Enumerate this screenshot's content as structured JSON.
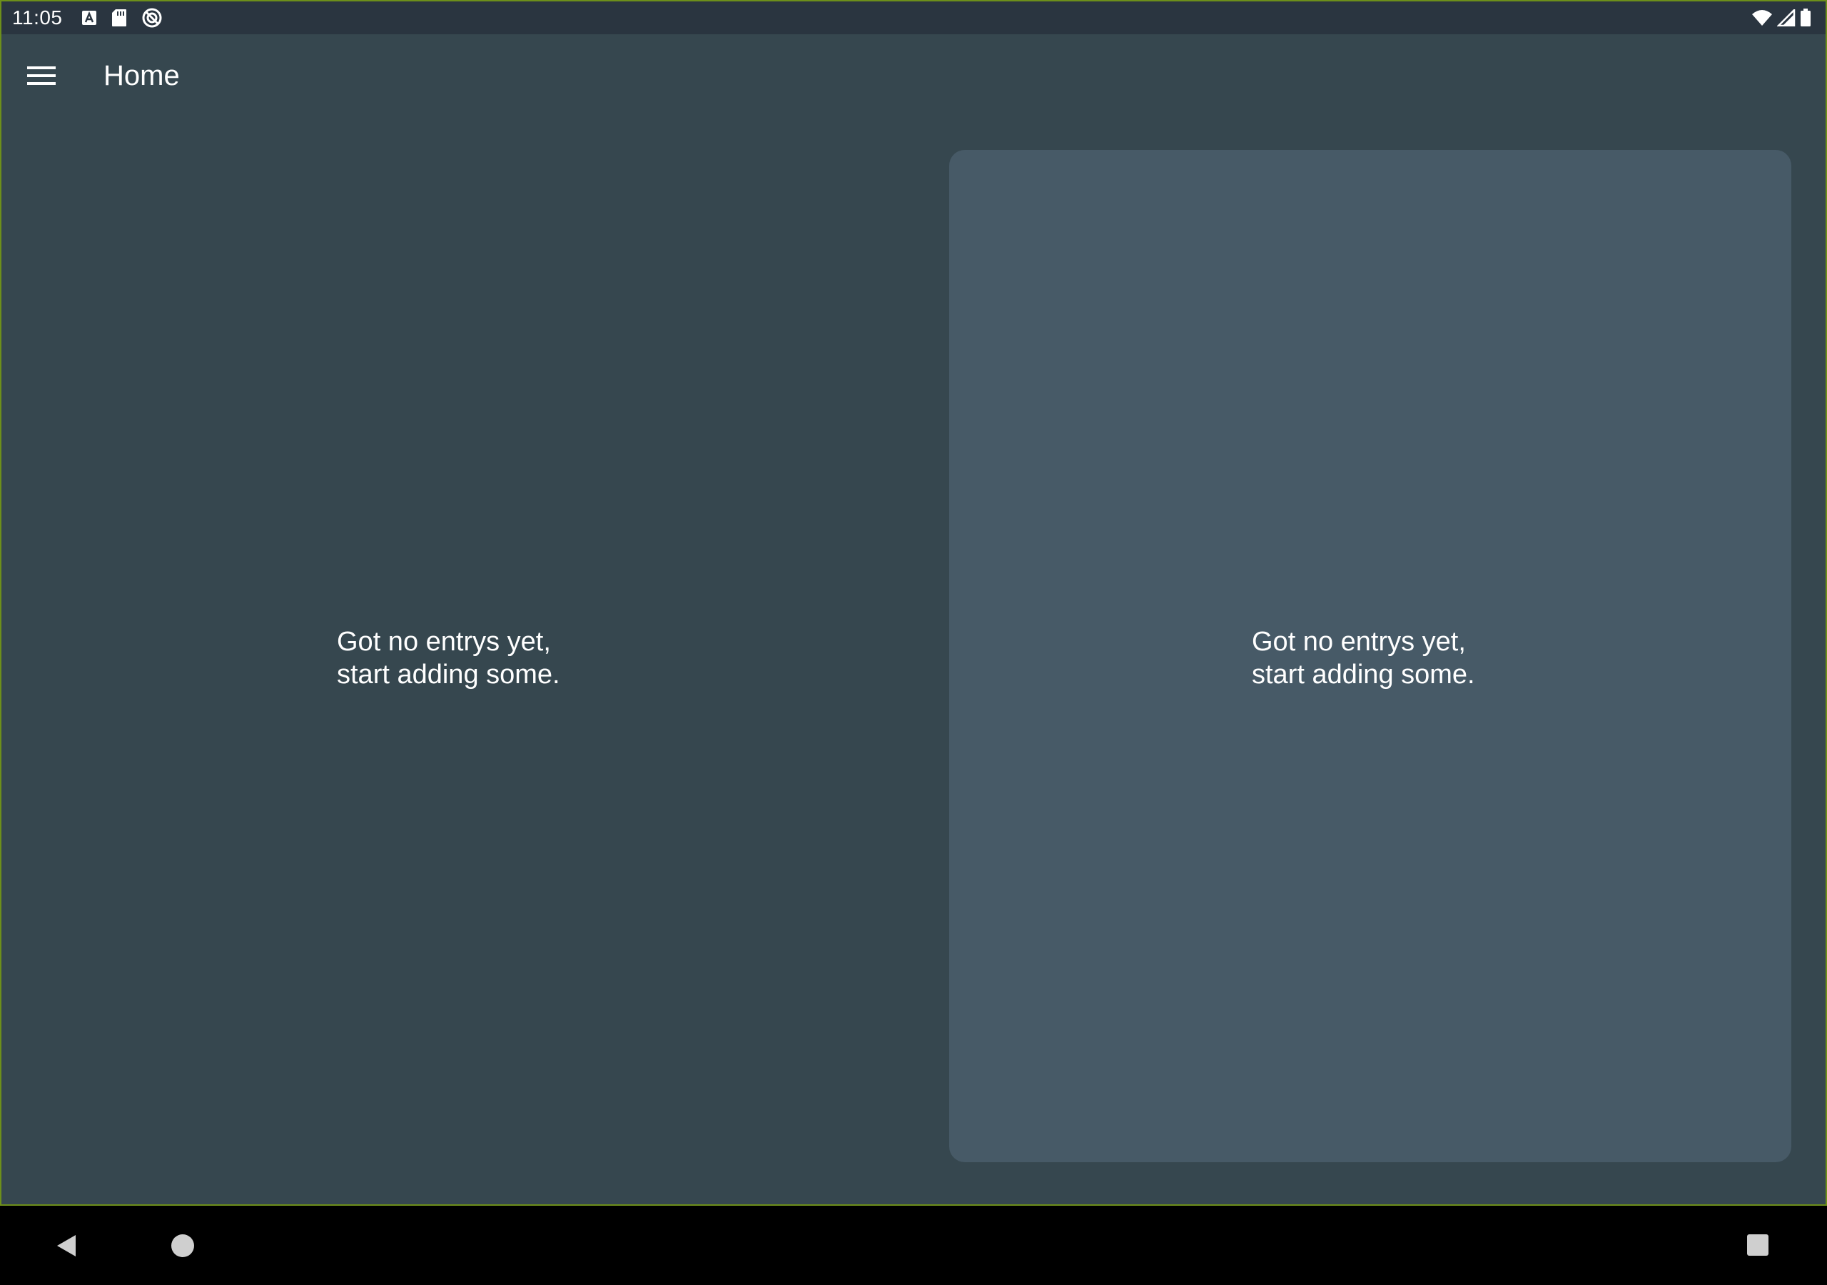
{
  "status_bar": {
    "time": "11:05",
    "left_icons": [
      "a-badge-icon",
      "sd-card-icon",
      "sync-blocked-icon"
    ],
    "right_icons": [
      "wifi-icon",
      "signal-icon",
      "battery-icon"
    ]
  },
  "app_bar": {
    "title": "Home",
    "menu_icon": "hamburger-menu-icon"
  },
  "left_pane": {
    "empty_line1": "Got no entrys yet,",
    "empty_line2": "start adding some."
  },
  "right_pane": {
    "empty_line1": "Got no entrys yet,",
    "empty_line2": "start adding some."
  },
  "nav_bar": {
    "icons": [
      "back-icon",
      "home-icon",
      "recents-icon"
    ]
  },
  "colors": {
    "background": "#36474f",
    "status_bar": "#2a3540",
    "card": "#475a67",
    "text": "#ffffff",
    "nav_bar": "#000000"
  }
}
